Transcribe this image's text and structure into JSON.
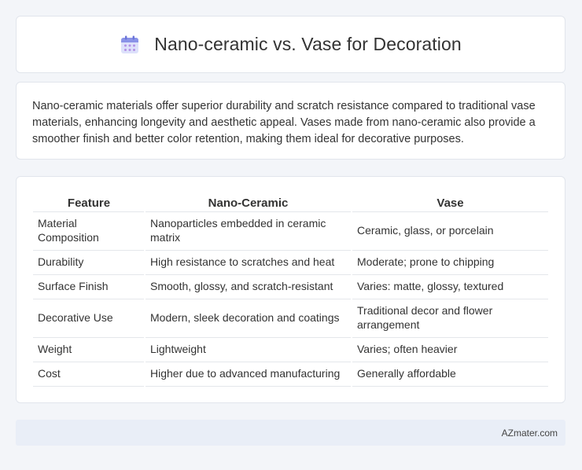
{
  "header": {
    "title": "Nano-ceramic vs. Vase for Decoration",
    "icon": "calendar-icon",
    "icon_colors": {
      "top": "#8a93e8",
      "body": "#dde1fb",
      "dots": "#b391e6"
    }
  },
  "description": {
    "text": "Nano-ceramic materials offer superior durability and scratch resistance compared to traditional vase materials, enhancing longevity and aesthetic appeal. Vases made from nano-ceramic also provide a smoother finish and better color retention, making them ideal for decorative purposes."
  },
  "table": {
    "columns": [
      "Feature",
      "Nano-Ceramic",
      "Vase"
    ],
    "rows": [
      [
        "Material Composition",
        "Nanoparticles embedded in ceramic matrix",
        "Ceramic, glass, or porcelain"
      ],
      [
        "Durability",
        "High resistance to scratches and heat",
        "Moderate; prone to chipping"
      ],
      [
        "Surface Finish",
        "Smooth, glossy, and scratch-resistant",
        "Varies: matte, glossy, textured"
      ],
      [
        "Decorative Use",
        "Modern, sleek decoration and coatings",
        "Traditional decor and flower arrangement"
      ],
      [
        "Weight",
        "Lightweight",
        "Varies; often heavier"
      ],
      [
        "Cost",
        "Higher due to advanced manufacturing",
        "Generally affordable"
      ]
    ]
  },
  "footer": {
    "site": "AZmater.com"
  }
}
